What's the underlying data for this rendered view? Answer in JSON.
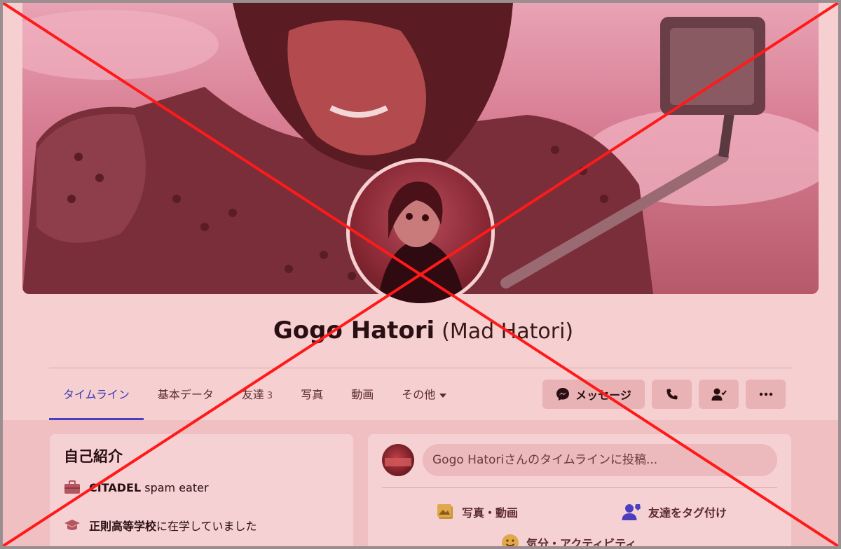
{
  "profile": {
    "name": "Gogo Hatori",
    "alternate_name": "(Mad Hatori)"
  },
  "tabs": [
    {
      "label": "タイムライン",
      "active": true
    },
    {
      "label": "基本データ"
    },
    {
      "label": "友達",
      "count": "3"
    },
    {
      "label": "写真"
    },
    {
      "label": "動画"
    },
    {
      "label": "その他"
    }
  ],
  "actions": {
    "message_label": "メッセージ",
    "icons": [
      "messenger-icon",
      "phone-icon",
      "friend-check-icon",
      "more-icon"
    ]
  },
  "intro": {
    "title": "自己紹介",
    "work_bold": "CITADEL",
    "work_rest": " spam eater",
    "school_bold": "正則高等学校",
    "school_rest": "に在学していました"
  },
  "composer": {
    "placeholder": "Gogo Hatoriさんのタイムラインに投稿...",
    "photo_video": "写真・動画",
    "tag_friends": "友達をタグ付け",
    "feeling": "気分・アクティビティ"
  },
  "colors": {
    "accent": "#4b3fbf",
    "overlay_x": "#ff1a1a"
  }
}
